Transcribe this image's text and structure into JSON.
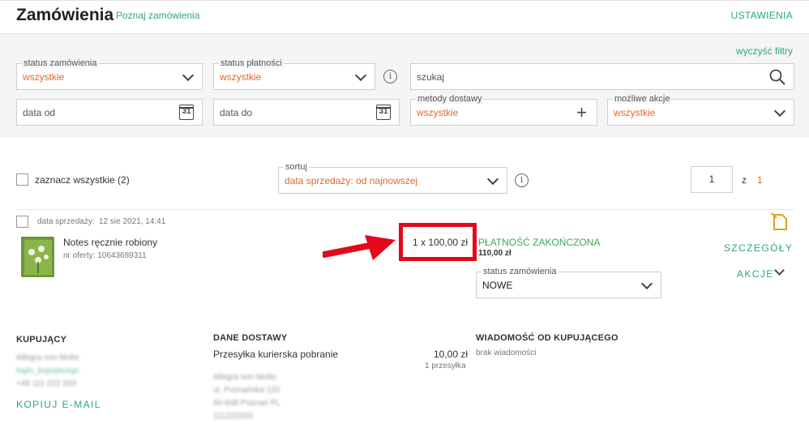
{
  "header": {
    "title": "Zamówienia",
    "learn_link": "Poznaj zamówienia",
    "settings": "USTAWIENIA"
  },
  "filters": {
    "clear": "wyczyść filtry",
    "order_status": {
      "legend": "status zamówienia",
      "value": "wszystkie"
    },
    "payment_status": {
      "legend": "status płatności",
      "value": "wszystkie"
    },
    "search": {
      "placeholder": "szukaj"
    },
    "date_from": {
      "placeholder": "data od",
      "cal": "31"
    },
    "date_to": {
      "placeholder": "data do",
      "cal": "31"
    },
    "delivery": {
      "legend": "metody dostawy",
      "value": "wszystkie"
    },
    "actions": {
      "legend": "możliwe akcje",
      "value": "wszystkie"
    }
  },
  "toolbar": {
    "select_all": "zaznacz wszystkie (2)",
    "sort": {
      "legend": "sortuj",
      "value": "data sprzedaży: od najnowszej"
    },
    "page": "1",
    "of_label": "z",
    "total_pages": "1"
  },
  "order": {
    "sale_date_label": "data sprzedaży:",
    "sale_date": "12 sie 2021, 14:41",
    "item_name": "Notes ręcznie robiony",
    "offer_no": "nr oferty: 10643689311",
    "quantity_price": "1 x 100,00 zł",
    "payment_status": "PŁATNOŚĆ ZAKOŃCZONA",
    "payment_amount": "110,00 zł",
    "status_legend": "status zamówienia",
    "status_value": "NOWE",
    "details": "SZCZEGÓŁY",
    "actions": "AKCJE",
    "buyer": {
      "header": "KUPUJĄCY",
      "name": "Allegra non Molto",
      "login": "login_kupujacego",
      "phone": "+48 111 222 333",
      "copy_email": "KOPIUJ E-MAIL"
    },
    "delivery": {
      "header": "DANE DOSTAWY",
      "method": "Przesyłka kurierska pobranie",
      "price": "10,00 zł",
      "packages": "1 przesyłka",
      "addr1": "Allegra non Molto",
      "addr2": "ul. Poznańska 120",
      "addr3": "60-848 Poznań PL",
      "addr4": "111222333"
    },
    "message": {
      "header": "WIADOMOŚĆ OD KUPUJĄCEGO",
      "text": "brak wiadomości"
    }
  },
  "colors": {
    "accent_teal": "#2aa58c",
    "value_orange": "#e8652a",
    "highlight_red": "#e3081b",
    "payment_green": "#3aaa5c"
  }
}
